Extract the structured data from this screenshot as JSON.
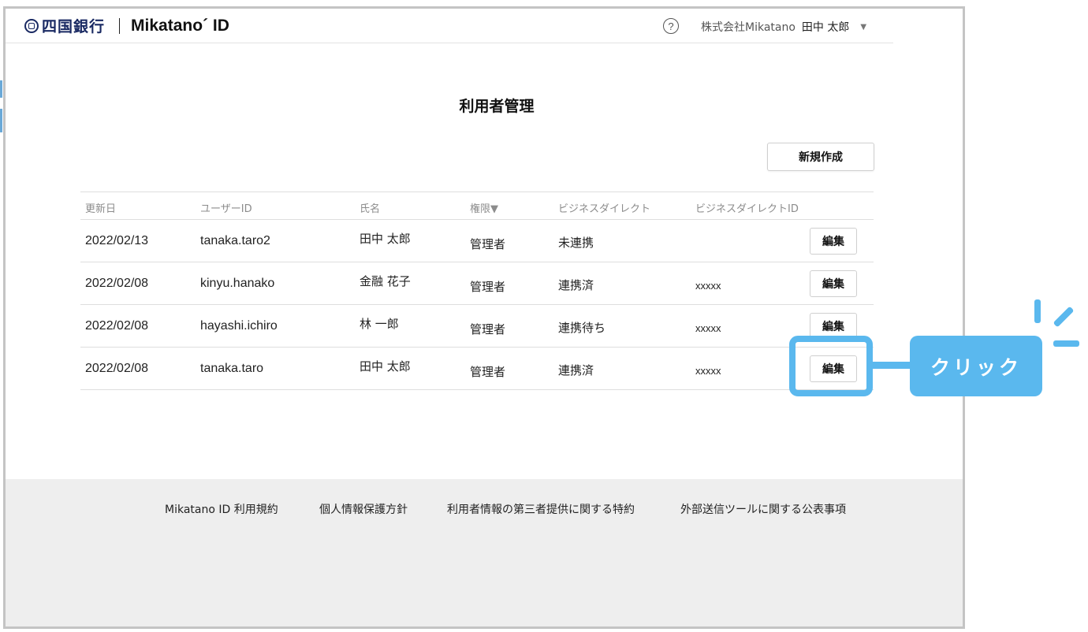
{
  "header": {
    "bank_name": "四国銀行",
    "product_name": "Mikatano´ ID",
    "help_icon": "?",
    "company": "株式会社Mikatano",
    "user_name": "田中 太郎",
    "caret": "▼"
  },
  "page": {
    "title": "利用者管理",
    "create_button_label": "新規作成"
  },
  "table": {
    "headers": {
      "date": "更新日",
      "user_id": "ユーザーID",
      "name": "氏名",
      "role": "権限▼",
      "business_direct": "ビジネスダイレクト",
      "business_direct_id": "ビジネスダイレクトID"
    },
    "rows": [
      {
        "date": "2022/02/13",
        "user_id": "tanaka.taro2",
        "name": "田中 太郎",
        "role": "管理者",
        "business_direct": "未連携",
        "business_direct_id": "",
        "edit_label": "編集"
      },
      {
        "date": "2022/02/08",
        "user_id": "kinyu.hanako",
        "name": "金融 花子",
        "role": "管理者",
        "business_direct": "連携済",
        "business_direct_id": "xxxxx",
        "edit_label": "編集"
      },
      {
        "date": "2022/02/08",
        "user_id": "hayashi.ichiro",
        "name": "林 一郎",
        "role": "管理者",
        "business_direct": "連携待ち",
        "business_direct_id": "xxxxx",
        "edit_label": "編集"
      },
      {
        "date": "2022/02/08",
        "user_id": "tanaka.taro",
        "name": "田中 太郎",
        "role": "管理者",
        "business_direct": "連携済",
        "business_direct_id": "xxxxx",
        "edit_label": "編集"
      }
    ]
  },
  "footer": {
    "links": [
      "Mikatano ID 利用規約",
      "個人情報保護方針",
      "利用者情報の第三者提供に関する特約",
      "外部送信ツールに関する公表事項"
    ]
  },
  "annotation": {
    "callout_label": "クリック",
    "accent_color": "#5ab8ee"
  }
}
